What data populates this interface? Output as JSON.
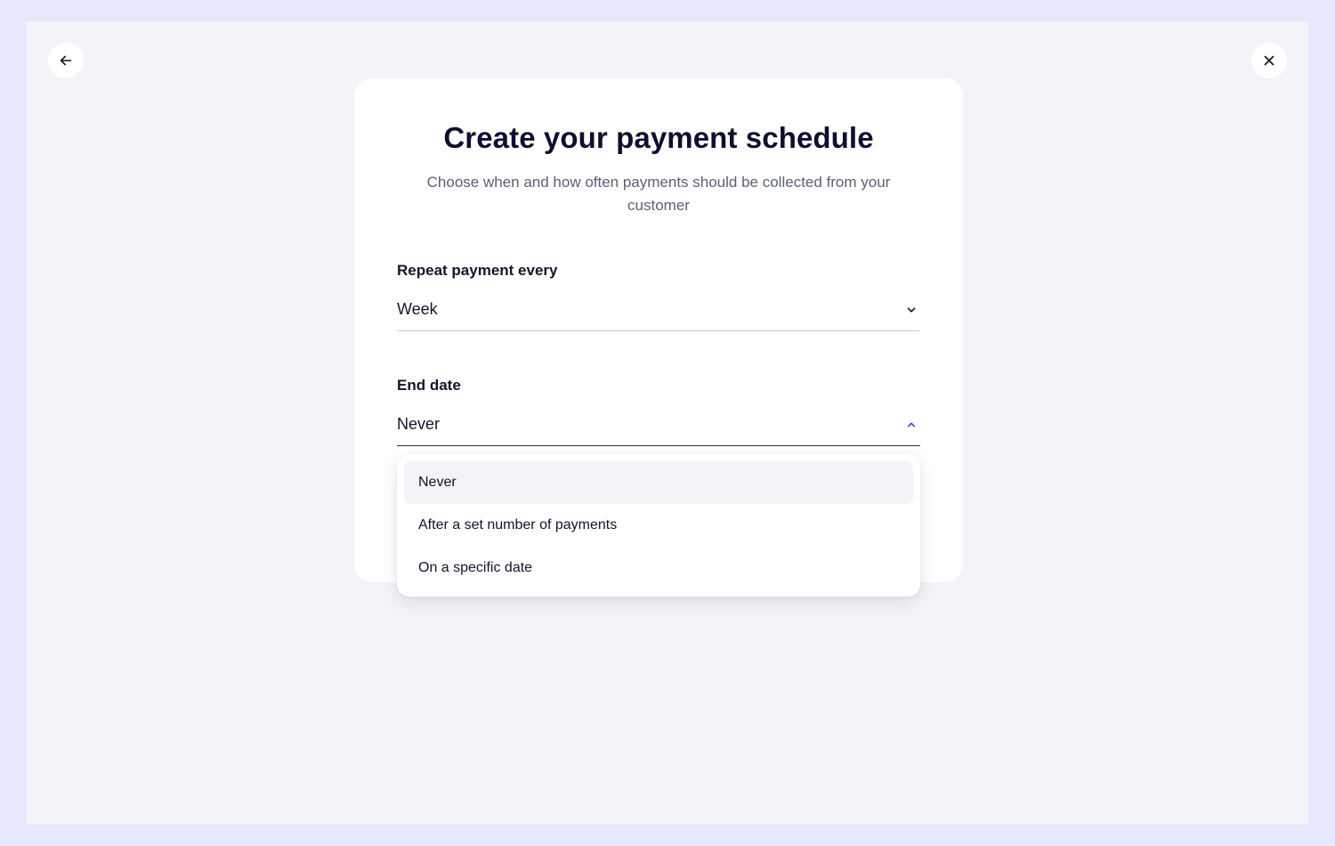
{
  "nav": {
    "back_icon": "arrow-left-icon",
    "close_icon": "close-icon"
  },
  "card": {
    "title": "Create your payment schedule",
    "subtitle": "Choose when and how often payments should be collected from your customer"
  },
  "repeat": {
    "label": "Repeat payment every",
    "value": "Week",
    "icon": "chevron-down-icon"
  },
  "end_date": {
    "label": "End date",
    "value": "Never",
    "icon": "chevron-up-icon",
    "options": [
      {
        "label": "Never",
        "selected": true
      },
      {
        "label": "After a set number of payments",
        "selected": false
      },
      {
        "label": "On a specific date",
        "selected": false
      }
    ]
  },
  "colors": {
    "outer_background": "#e7e7fd",
    "frame_background": "#f3f4f8",
    "card_background": "#ffffff",
    "text_primary": "#0e0f2e",
    "text_secondary": "#5c5f73",
    "accent": "#4b4bd6"
  }
}
